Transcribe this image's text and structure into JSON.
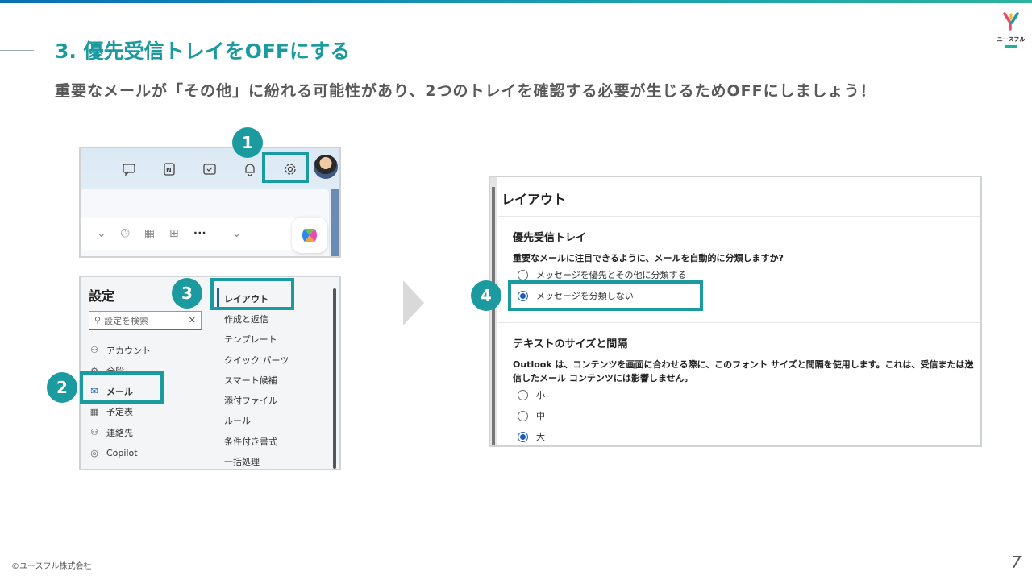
{
  "slide": {
    "title": "3. 優先受信トレイをOFFにする",
    "subtitle": "重要なメールが「その他」に紛れる可能性があり、2つのトレイを確認する必要が生じるためOFFにしましょう！",
    "footer": "©ユースフル株式会社",
    "page_number": "7",
    "accent_color": "#1b9aa0"
  },
  "logo": {
    "text": "ユースフル"
  },
  "steps": {
    "s1": "1",
    "s2": "2",
    "s3": "3",
    "s4": "4"
  },
  "toolbar": {
    "icons": [
      "chat-icon",
      "onenote-icon",
      "todo-icon",
      "bell-icon",
      "gear-icon"
    ],
    "more": "···"
  },
  "settings": {
    "title": "設定",
    "search_placeholder": "設定を検索",
    "nav": [
      {
        "icon": "person-icon",
        "label": "アカウント"
      },
      {
        "icon": "gear-icon",
        "label": "全般"
      },
      {
        "icon": "mail-icon",
        "label": "メール"
      },
      {
        "icon": "calendar-icon",
        "label": "予定表"
      },
      {
        "icon": "people-icon",
        "label": "連絡先"
      },
      {
        "icon": "copilot-icon",
        "label": "Copilot"
      }
    ],
    "sub": [
      "レイアウト",
      "作成と返信",
      "テンプレート",
      "クイック パーツ",
      "スマート候補",
      "添付ファイル",
      "ルール",
      "条件付き書式",
      "一括処理"
    ]
  },
  "layout_pane": {
    "heading": "レイアウト",
    "focused": {
      "title": "優先受信トレイ",
      "question": "重要なメールに注目できるように、メールを自動的に分類しますか?",
      "options": [
        "メッセージを優先とその他に分類する",
        "メッセージを分類しない"
      ],
      "selected": 1
    },
    "text_size": {
      "title": "テキストのサイズと間隔",
      "desc": "Outlook は、コンテンツを画面に合わせる際に、このフォント サイズと間隔を使用します。これは、受信または送信したメール コンテンツには影響しません。",
      "options": [
        "小",
        "中",
        "大"
      ],
      "selected": 2
    }
  }
}
